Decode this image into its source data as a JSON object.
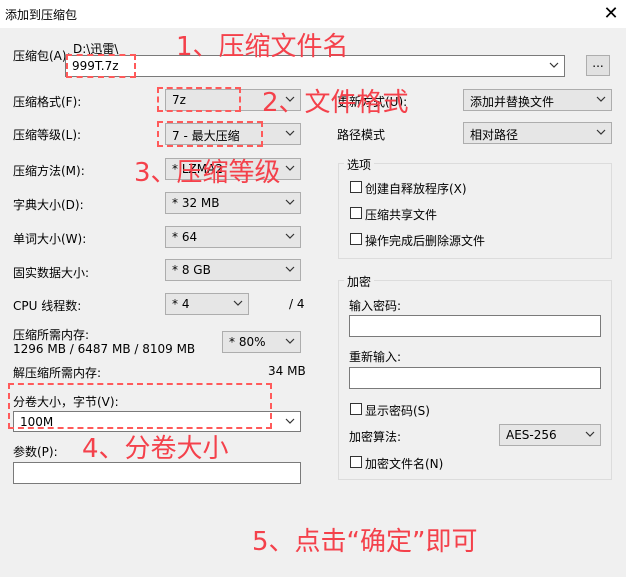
{
  "window": {
    "title": "添加到压缩包",
    "close_glyph": "✕"
  },
  "left": {
    "archive_label": "压缩包(A):",
    "archive_path": "D:\\迅雷\\",
    "archive_value": "999T.7z",
    "browse_label": "...",
    "format_label": "压缩格式(F):",
    "format_value": "7z",
    "level_label": "压缩等级(L):",
    "level_value": "7 - 最大压缩",
    "method_label": "压缩方法(M):",
    "method_value": "* LZMA2",
    "dict_label": "字典大小(D):",
    "dict_value": "* 32 MB",
    "word_label": "单词大小(W):",
    "word_value": "* 64",
    "solid_label": "固实数据大小:",
    "solid_value": "* 8 GB",
    "cpu_label": "CPU 线程数:",
    "cpu_value": "* 4",
    "cpu_total": "/ 4",
    "mem_label": "压缩所需内存:",
    "mem_value": "1296 MB / 6487 MB / 8109 MB",
    "mem_percent": "* 80%",
    "decomp_label": "解压缩所需内存:",
    "decomp_value": "34 MB",
    "split_label": "分卷大小，字节(V):",
    "split_value": "100M",
    "params_label": "参数(P):",
    "params_value": ""
  },
  "right": {
    "update_label": "更新方式(U):",
    "update_value": "添加并替换文件",
    "path_label": "路径模式",
    "path_value": "相对路径",
    "options_title": "选项",
    "opt_sfx": "创建自释放程序(X)",
    "opt_shared": "压缩共享文件",
    "opt_delete": "操作完成后删除源文件",
    "enc_title": "加密",
    "pwd_label": "输入密码:",
    "pwd_value": "",
    "repwd_label": "重新输入:",
    "repwd_value": "",
    "show_pwd": "显示密码(S)",
    "enc_method_label": "加密算法:",
    "enc_method_value": "AES-256",
    "enc_names": "加密文件名(N)"
  },
  "annotations": {
    "a1": "1、压缩文件名",
    "a2": "2、文件格式",
    "a3": "3、压缩等级",
    "a4": "4、分卷大小",
    "a5": "5、点击“确定”即可",
    "color": "#f4414b"
  }
}
